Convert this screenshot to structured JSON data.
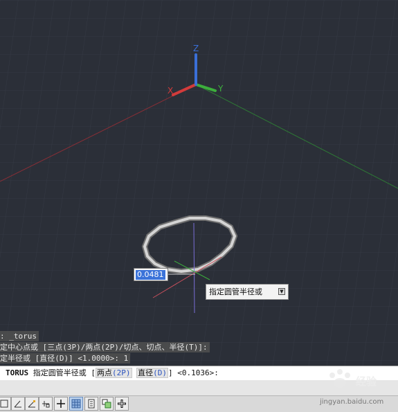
{
  "viewport": {
    "ucs": {
      "x": "X",
      "y": "Y",
      "z": "Z"
    },
    "dynamic_input_value": "0.0481",
    "tooltip": "指定圆管半径或"
  },
  "command_history": [
    ": _torus",
    "定中心点或 [三点(3P)/两点(2P)/切点、切点、半径(T)]:",
    "定半径或 [直径(D)] <1.0000>: 1"
  ],
  "command_line": {
    "command": "TORUS",
    "prompt": "指定圆管半径或",
    "open_bracket": "[",
    "option1_text": "两点",
    "option1_key": "(2P)",
    "option2_text": "直径",
    "option2_key": "(D)",
    "close_bracket": "]",
    "default": "<0.1036>:"
  },
  "status_bar": {
    "buttons": [
      "grid-mode",
      "polar-tracking",
      "object-snap-tracking",
      "object-snap",
      "ortho",
      "dynamic-ucs",
      "lineweight",
      "transparency",
      "selection-cycling",
      "dynamic-input"
    ]
  },
  "watermark": "jingyan.baidu.com",
  "colors": {
    "background": "#2b2f38",
    "x_axis": "#d23b3b",
    "y_axis": "#3cae3c",
    "z_axis": "#3a6fd8"
  }
}
